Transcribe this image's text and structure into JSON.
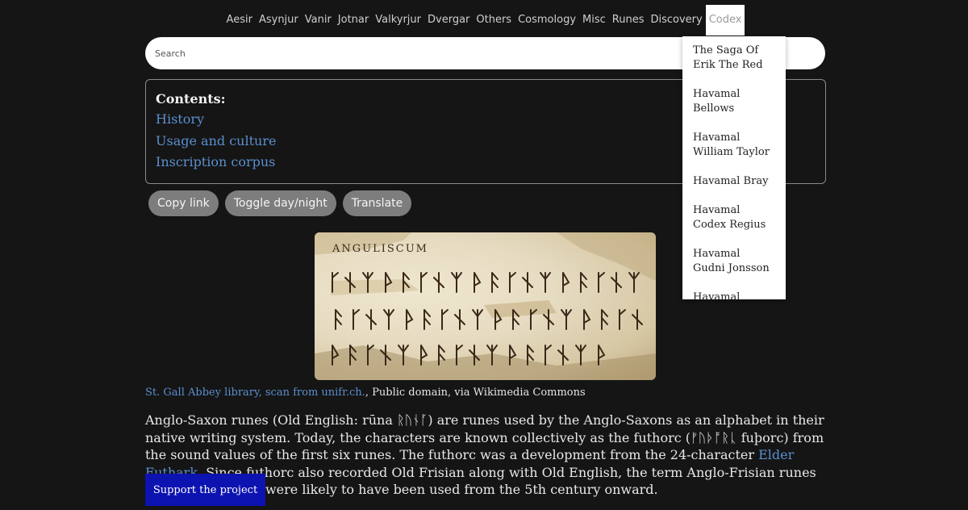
{
  "nav": {
    "items": [
      "Aesir",
      "Asynjur",
      "Vanir",
      "Jotnar",
      "Valkyrjur",
      "Dvergar",
      "Others",
      "Cosmology",
      "Misc",
      "Runes",
      "Discovery",
      "Codex"
    ],
    "active": "Codex"
  },
  "search": {
    "placeholder": "Search",
    "value": ""
  },
  "toc": {
    "title": "Contents:",
    "links": [
      "History",
      "Usage and culture",
      "Inscription corpus"
    ]
  },
  "buttons": {
    "copy_link": "Copy link",
    "toggle_day_night": "Toggle day/night",
    "translate": "Translate"
  },
  "image": {
    "caption_link": "St. Gall Abbey library, scan from unifr.ch.",
    "caption_rest": ", Public domain, via Wikimedia Commons",
    "handwritten_heading": "ANGULISCUM"
  },
  "article": {
    "part1": "Anglo-Saxon runes (Old English: rūna ᚱᚢᚾᚪ) are runes used by the Anglo-Saxons as an alphabet in their native writing system. Today, the characters are known collectively as the futhorc (ᚠᚢᚦᚩᚱᚳ fuþorc) from the sound values of the first six runes. The futhorc was a development from the 24-character ",
    "link": "Elder Futhark",
    "part2": ". Since futhorc also recorded Old Frisian along with Old English, the term Anglo-Frisian runes is also used. They were likely to have been used from the 5th century onward."
  },
  "support_button": "Support the project",
  "codex_menu": {
    "items": [
      "The Saga Of Erik The Red",
      "Havamal Bellows",
      "Havamal William Taylor",
      "Havamal Bray",
      "Havamal Codex Regius",
      "Havamal Gudni Jonsson",
      "Havamal"
    ]
  },
  "colors": {
    "background": "#151515",
    "link": "#5b8fcf",
    "support": "#0d13b0",
    "pill": "#7d7d7d"
  }
}
